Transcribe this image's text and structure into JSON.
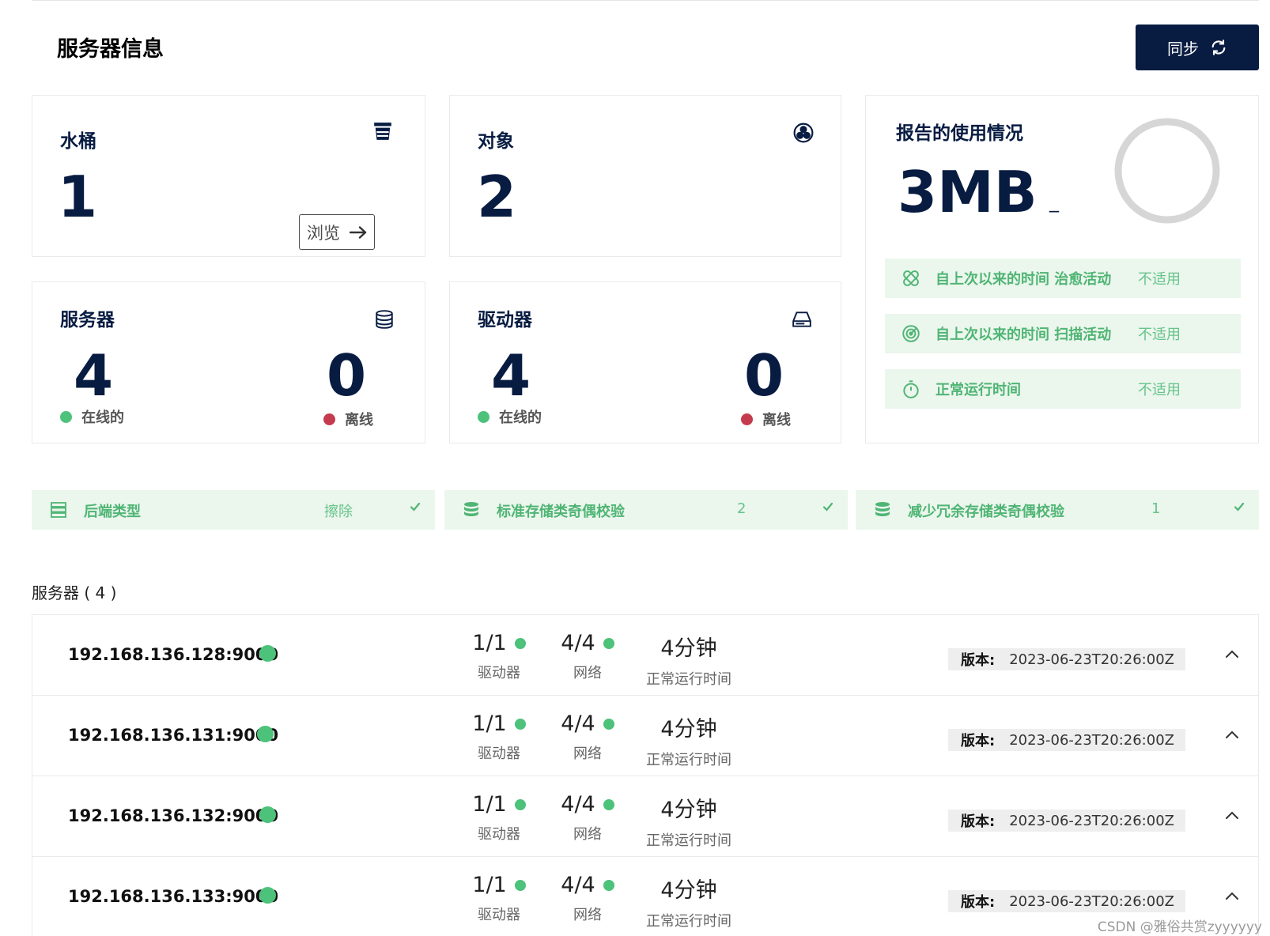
{
  "header": {
    "title": "服务器信息",
    "sync_label": "同步"
  },
  "cards": {
    "buckets": {
      "title": "水桶",
      "count": "1",
      "browse_label": "浏览"
    },
    "objects": {
      "title": "对象",
      "count": "2"
    },
    "servers": {
      "title": "服务器",
      "online_count": "4",
      "online_label": "在线的",
      "offline_count": "0",
      "offline_label": "离线"
    },
    "drives": {
      "title": "驱动器",
      "online_count": "4",
      "online_label": "在线的",
      "offline_count": "0",
      "offline_label": "离线"
    }
  },
  "usage": {
    "title": "报告的使用情况",
    "value": "3MB",
    "suffix": "_",
    "stats": [
      {
        "label": "自上次以来的时间 治愈活动",
        "value": "不适用"
      },
      {
        "label": "自上次以来的时间 扫描活动",
        "value": "不适用"
      },
      {
        "label": "正常运行时间",
        "value": "不适用"
      }
    ]
  },
  "backend": [
    {
      "label": "后端类型",
      "value": "擦除"
    },
    {
      "label": "标准存储类奇偶校验",
      "value": "2"
    },
    {
      "label": "减少冗余存储类奇偶校验",
      "value": "1"
    }
  ],
  "servers_section": {
    "heading": "服务器 ( 4 )",
    "rows": [
      {
        "address": "192.168.136.128:9000",
        "drives": "1/1",
        "drives_label": "驱动器",
        "network": "4/4",
        "network_label": "网络",
        "uptime": "4分钟",
        "uptime_label": "正常运行时间",
        "version_label": "版本:",
        "version": "2023-06-23T20:26:00Z"
      },
      {
        "address": "192.168.136.131:9000",
        "drives": "1/1",
        "drives_label": "驱动器",
        "network": "4/4",
        "network_label": "网络",
        "uptime": "4分钟",
        "uptime_label": "正常运行时间",
        "version_label": "版本:",
        "version": "2023-06-23T20:26:00Z"
      },
      {
        "address": "192.168.136.132:9000",
        "drives": "1/1",
        "drives_label": "驱动器",
        "network": "4/4",
        "network_label": "网络",
        "uptime": "4分钟",
        "uptime_label": "正常运行时间",
        "version_label": "版本:",
        "version": "2023-06-23T20:26:00Z"
      },
      {
        "address": "192.168.136.133:9000",
        "drives": "1/1",
        "drives_label": "驱动器",
        "network": "4/4",
        "network_label": "网络",
        "uptime": "4分钟",
        "uptime_label": "正常运行时间",
        "version_label": "版本:",
        "version": "2023-06-23T20:26:00Z"
      }
    ]
  },
  "watermark": "CSDN @雅俗共赏zyyyyyy",
  "colors": {
    "navy": "#081c42",
    "green": "#4cc27a",
    "red": "#c53b4e",
    "mint": "#ebf6ed"
  }
}
